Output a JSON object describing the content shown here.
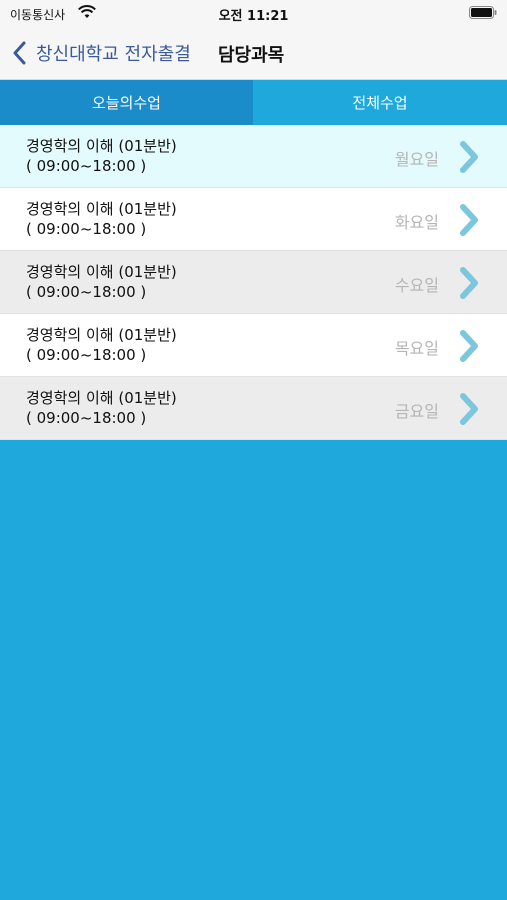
{
  "status_bar": {
    "carrier": "이동통신사",
    "time": "오전 11:21",
    "icons": [
      "wifi-icon",
      "battery-icon"
    ]
  },
  "nav": {
    "back_label": "창신대학교 전자출결",
    "title": "담당과목",
    "back_icon": "chevron-left-icon"
  },
  "tabs": [
    {
      "label": "오늘의수업",
      "selected": true
    },
    {
      "label": "전체수업",
      "selected": false
    }
  ],
  "classes": [
    {
      "name": "경영학의 이해 (01분반)",
      "time": "( 09:00~18:00 )",
      "day": "월요일",
      "bg": "#e4fbfd"
    },
    {
      "name": "경영학의 이해 (01분반)",
      "time": "( 09:00~18:00 )",
      "day": "화요일",
      "bg": "#ffffff"
    },
    {
      "name": "경영학의 이해 (01분반)",
      "time": "( 09:00~18:00 )",
      "day": "수요일",
      "bg": "#ececec"
    },
    {
      "name": "경영학의 이해 (01분반)",
      "time": "( 09:00~18:00 )",
      "day": "목요일",
      "bg": "#ffffff"
    },
    {
      "name": "경영학의 이해 (01분반)",
      "time": "( 09:00~18:00 )",
      "day": "금요일",
      "bg": "#ececec"
    }
  ],
  "colors": {
    "accent": "#1ea8dc",
    "tab_selected": "#1a8cc9",
    "back_text": "#3a5a9a",
    "chevron": "#7cc6de"
  }
}
